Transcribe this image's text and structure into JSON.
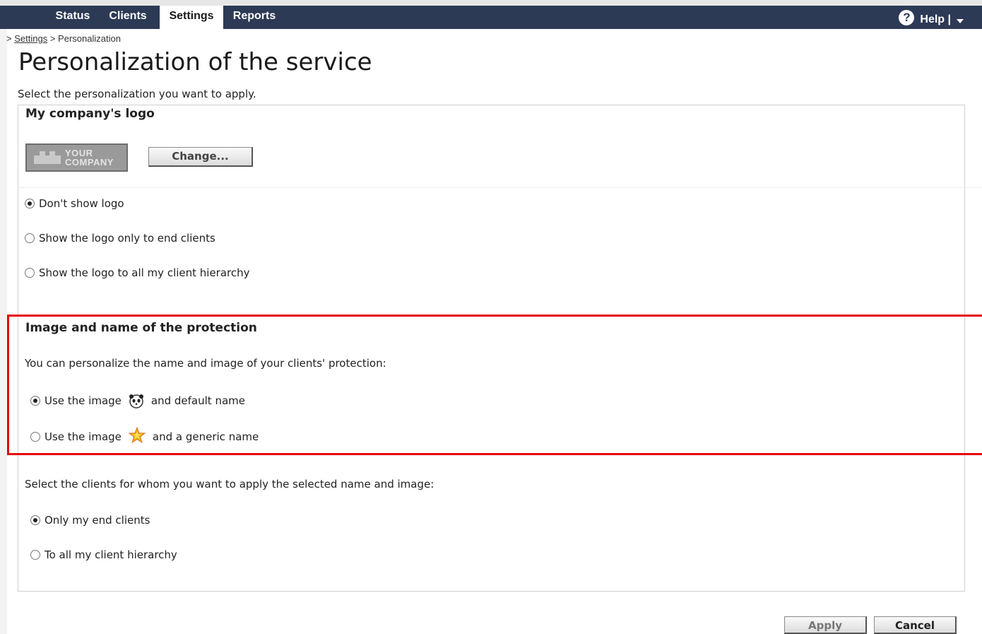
{
  "nav": {
    "tabs": [
      {
        "label": "Status"
      },
      {
        "label": "Clients"
      },
      {
        "label": "Settings"
      },
      {
        "label": "Reports"
      }
    ],
    "active_tab": "Settings",
    "help_label": "Help |"
  },
  "breadcrumb": {
    "prefix": ">",
    "link": "Settings",
    "separator": ">",
    "current": "Personalization"
  },
  "page": {
    "title": "Personalization of the service",
    "intro": "Select the personalization you want to apply."
  },
  "logo_section": {
    "title": "My company's logo",
    "logo_line1": "YOUR",
    "logo_line2": "COMPANY",
    "change_label": "Change...",
    "options": [
      {
        "label": "Don't show logo",
        "checked": true
      },
      {
        "label": "Show the logo only to end clients",
        "checked": false
      },
      {
        "label": "Show the logo to all my client hierarchy",
        "checked": false
      }
    ]
  },
  "protection_section": {
    "title": "Image and name of the protection",
    "description": "You can personalize the name and image of your clients' protection:",
    "option1_prefix": "Use the image",
    "option1_suffix": "and default name",
    "option1_checked": true,
    "option1_icon": "panda-icon",
    "option2_prefix": "Use the image",
    "option2_suffix": "and a generic name",
    "option2_checked": false,
    "option2_icon": "star-icon"
  },
  "clients_section": {
    "description": "Select the clients for whom you want to apply the selected name and image:",
    "options": [
      {
        "label": "Only my end clients",
        "checked": true
      },
      {
        "label": "To all my client hierarchy",
        "checked": false
      }
    ]
  },
  "actions": {
    "apply_label": "Apply",
    "cancel_label": "Cancel"
  },
  "colors": {
    "navbar": "#2c3a55",
    "highlight": "#e60000"
  }
}
